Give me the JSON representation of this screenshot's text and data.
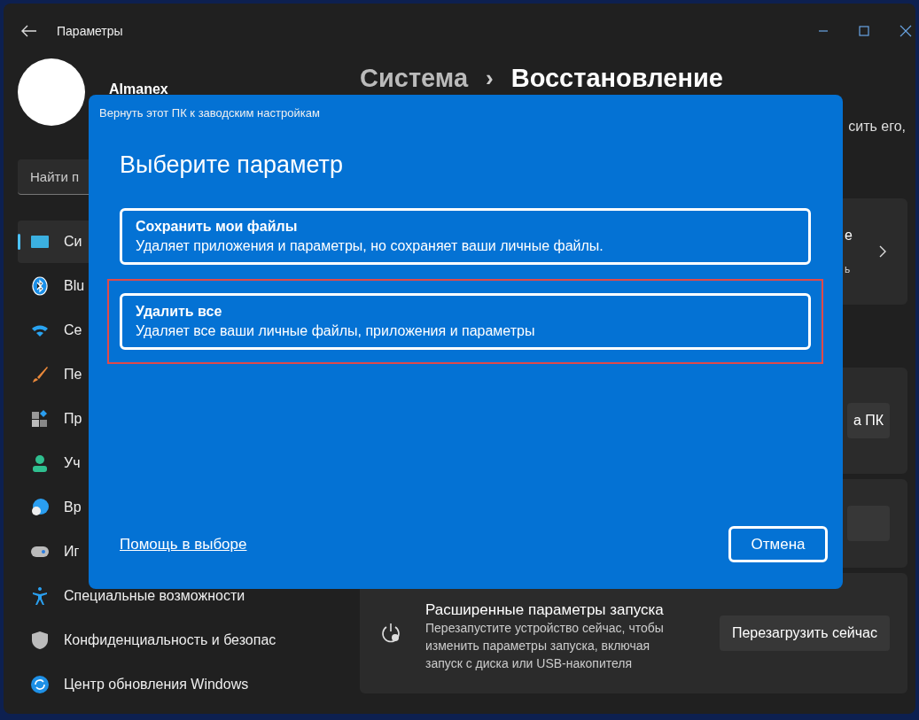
{
  "window": {
    "title": "Параметры"
  },
  "profile": {
    "name": "Almanex"
  },
  "search": {
    "placeholder": "Найти п"
  },
  "sidebar": {
    "items": [
      {
        "label": "Си",
        "selected": true
      },
      {
        "label": "Blu",
        "selected": false
      },
      {
        "label": "Се",
        "selected": false
      },
      {
        "label": "Пе",
        "selected": false
      },
      {
        "label": "Пр",
        "selected": false
      },
      {
        "label": "Уч",
        "selected": false
      },
      {
        "label": "Вр",
        "selected": false
      },
      {
        "label": "Иг",
        "selected": false
      },
      {
        "label": "Специальные возможности",
        "selected": false
      },
      {
        "label": "Конфиденциальность и безопас",
        "selected": false
      },
      {
        "label": "Центр обновления Windows",
        "selected": false
      }
    ]
  },
  "breadcrumb": {
    "parent": "Система",
    "separator": "›",
    "current": "Восстановление"
  },
  "intro_fragment": "сить его,",
  "cards": [
    {
      "kind": "link",
      "title": "е",
      "subtitle": "ь"
    },
    {
      "kind": "button",
      "button": "а ПК"
    },
    {
      "kind": "button"
    },
    {
      "kind": "detail",
      "title": "Расширенные параметры запуска",
      "description": "Перезапустите устройство сейчас, чтобы изменить параметры запуска, включая запуск с диска или USB-накопителя",
      "button": "Перезагрузить сейчас"
    }
  ],
  "dialog": {
    "title": "Вернуть этот ПК к заводским настройкам",
    "heading": "Выберите параметр",
    "options": [
      {
        "title": "Сохранить мои файлы",
        "description": "Удаляет приложения и параметры, но сохраняет ваши личные файлы.",
        "highlighted": false
      },
      {
        "title": "Удалить все",
        "description": "Удаляет все ваши личные файлы, приложения и параметры",
        "highlighted": true
      }
    ],
    "help_link": "Помощь в выборе",
    "cancel": "Отмена"
  }
}
